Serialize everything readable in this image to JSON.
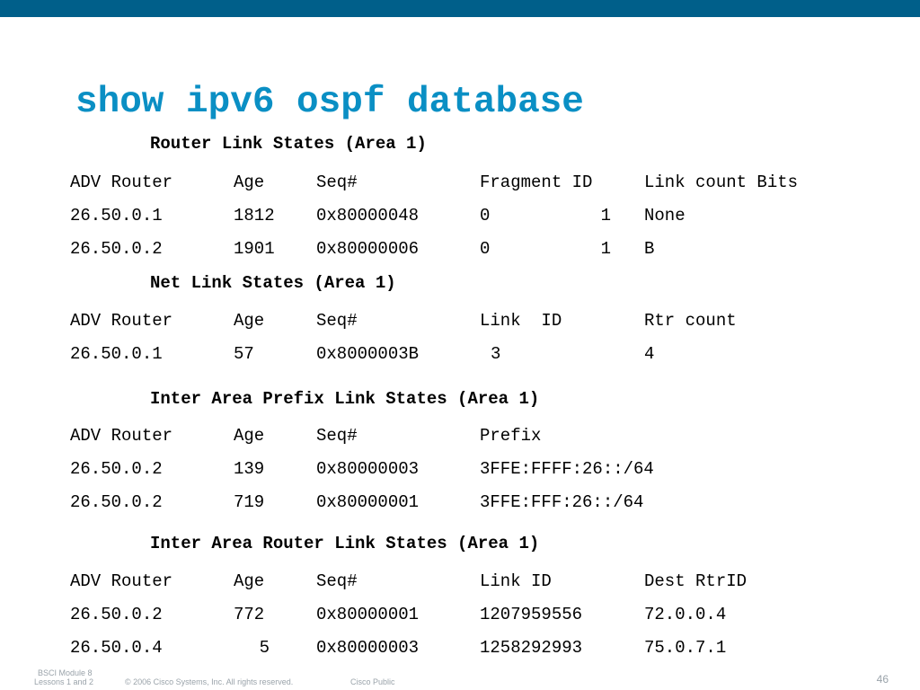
{
  "title": "show ipv6 ospf database",
  "colors": {
    "top_bar": "#005f8a",
    "title": "#0a8fc4",
    "footer": "#9aa3aa"
  },
  "sections": {
    "router_link": {
      "heading": "Router Link States (Area 1)",
      "header": [
        "ADV Router",
        "Age",
        "Seq#",
        "Fragment ID",
        "Link count Bits"
      ],
      "rows": [
        [
          "26.50.0.1",
          "1812",
          "0x80000048",
          "0",
          "1",
          "None"
        ],
        [
          "26.50.0.2",
          "1901",
          "0x80000006",
          "0",
          "1",
          "B"
        ]
      ]
    },
    "net_link": {
      "heading": "Net Link States (Area 1)",
      "header": [
        "ADV Router",
        "Age",
        "Seq#",
        "Link  ID",
        "Rtr count"
      ],
      "rows": [
        [
          "26.50.0.1",
          "57",
          "0x8000003B",
          "3",
          "4"
        ]
      ]
    },
    "inter_area_prefix": {
      "heading": "Inter Area Prefix Link States (Area 1)",
      "header": [
        "ADV Router",
        "Age",
        "Seq#",
        "Prefix"
      ],
      "rows": [
        [
          "26.50.0.2",
          "139",
          "0x80000003",
          "3FFE:FFFF:26::/64"
        ],
        [
          "26.50.0.2",
          "719",
          "0x80000001",
          "3FFE:FFF:26::/64"
        ]
      ]
    },
    "inter_area_router": {
      "heading": "Inter Area Router Link States (Area 1)",
      "header": [
        "ADV Router",
        "Age",
        "Seq#",
        "Link ID",
        "Dest RtrID"
      ],
      "rows": [
        [
          "26.50.0.2",
          "772",
          "0x80000001",
          "1207959556",
          "72.0.0.4"
        ],
        [
          "26.50.0.4",
          "5",
          "0x80000003",
          "1258292993",
          "75.0.7.1"
        ]
      ]
    }
  },
  "footer": {
    "module_line1": "BSCI Module 8",
    "module_line2": "Lessons 1 and 2",
    "copyright": "© 2006 Cisco Systems, Inc. All rights reserved.",
    "classification": "Cisco Public",
    "page_number": "46"
  }
}
